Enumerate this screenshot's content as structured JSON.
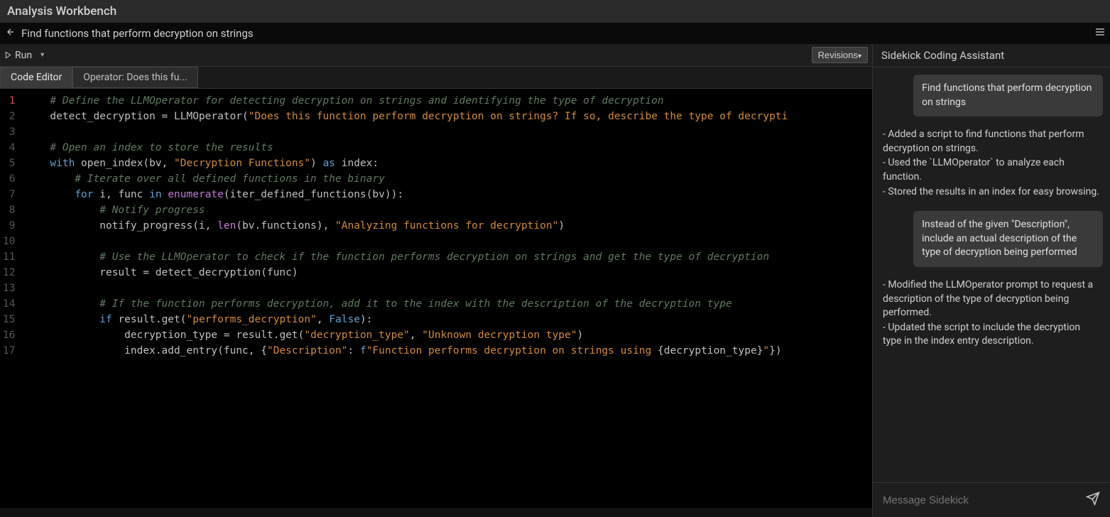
{
  "app": {
    "title": "Analysis Workbench"
  },
  "search": {
    "query": "Find functions that perform decryption on strings"
  },
  "toolbar": {
    "run_label": "Run",
    "revisions_label": "Revisions"
  },
  "tabs": [
    {
      "label": "Code Editor",
      "active": true
    },
    {
      "label": "Operator: Does this fu...",
      "active": false
    }
  ],
  "editor": {
    "lines": [
      {
        "n": 1,
        "tokens": [
          [
            "    ",
            ""
          ],
          [
            "# Define the LLMOperator for detecting decryption on strings and identifying the type of decryption",
            "c-comment"
          ]
        ]
      },
      {
        "n": 2,
        "tokens": [
          [
            "    ",
            ""
          ],
          [
            "detect_decryption",
            "c-ident"
          ],
          [
            " ",
            ""
          ],
          [
            "=",
            "c-op"
          ],
          [
            " ",
            ""
          ],
          [
            "LLMOperator",
            "c-call"
          ],
          [
            "(",
            "c-punct"
          ],
          [
            "\"Does this function perform decryption on strings? If so, describe the type of decrypti",
            "c-string"
          ]
        ]
      },
      {
        "n": 3,
        "tokens": [
          [
            "",
            ""
          ]
        ]
      },
      {
        "n": 4,
        "tokens": [
          [
            "    ",
            ""
          ],
          [
            "# Open an index to store the results",
            "c-comment"
          ]
        ]
      },
      {
        "n": 5,
        "tokens": [
          [
            "    ",
            ""
          ],
          [
            "with",
            "c-kw"
          ],
          [
            " ",
            ""
          ],
          [
            "open_index",
            "c-call"
          ],
          [
            "(",
            "c-punct"
          ],
          [
            "bv",
            "c-ident"
          ],
          [
            ", ",
            "c-punct"
          ],
          [
            "\"Decryption Functions\"",
            "c-string"
          ],
          [
            ")",
            "c-punct"
          ],
          [
            " ",
            ""
          ],
          [
            "as",
            "c-kw"
          ],
          [
            " ",
            ""
          ],
          [
            "index",
            "c-ident"
          ],
          [
            ":",
            "c-punct"
          ]
        ]
      },
      {
        "n": 6,
        "tokens": [
          [
            "        ",
            ""
          ],
          [
            "# Iterate over all defined functions in the binary",
            "c-comment"
          ]
        ]
      },
      {
        "n": 7,
        "tokens": [
          [
            "        ",
            ""
          ],
          [
            "for",
            "c-kw"
          ],
          [
            " ",
            ""
          ],
          [
            "i",
            "c-ident"
          ],
          [
            ", ",
            "c-punct"
          ],
          [
            "func",
            "c-ident"
          ],
          [
            " ",
            ""
          ],
          [
            "in",
            "c-kw"
          ],
          [
            " ",
            ""
          ],
          [
            "enumerate",
            "c-builtin"
          ],
          [
            "(",
            "c-punct"
          ],
          [
            "iter_defined_functions",
            "c-call"
          ],
          [
            "(",
            "c-punct"
          ],
          [
            "bv",
            "c-ident"
          ],
          [
            "))",
            "c-punct"
          ],
          [
            ":",
            "c-punct"
          ]
        ]
      },
      {
        "n": 8,
        "tokens": [
          [
            "            ",
            ""
          ],
          [
            "# Notify progress",
            "c-comment"
          ]
        ]
      },
      {
        "n": 9,
        "tokens": [
          [
            "            ",
            ""
          ],
          [
            "notify_progress",
            "c-call"
          ],
          [
            "(",
            "c-punct"
          ],
          [
            "i",
            "c-ident"
          ],
          [
            ", ",
            "c-punct"
          ],
          [
            "len",
            "c-builtin"
          ],
          [
            "(",
            "c-punct"
          ],
          [
            "bv",
            "c-ident"
          ],
          [
            ".",
            "c-punct"
          ],
          [
            "functions",
            "c-ident"
          ],
          [
            ")",
            "c-punct"
          ],
          [
            ", ",
            "c-punct"
          ],
          [
            "\"Analyzing functions for decryption\"",
            "c-string"
          ],
          [
            ")",
            "c-punct"
          ]
        ]
      },
      {
        "n": 10,
        "tokens": [
          [
            "",
            ""
          ]
        ]
      },
      {
        "n": 11,
        "tokens": [
          [
            "            ",
            ""
          ],
          [
            "# Use the LLMOperator to check if the function performs decryption on strings and get the type of decryption",
            "c-comment"
          ]
        ]
      },
      {
        "n": 12,
        "tokens": [
          [
            "            ",
            ""
          ],
          [
            "result",
            "c-ident"
          ],
          [
            " ",
            ""
          ],
          [
            "=",
            "c-op"
          ],
          [
            " ",
            ""
          ],
          [
            "detect_decryption",
            "c-call"
          ],
          [
            "(",
            "c-punct"
          ],
          [
            "func",
            "c-ident"
          ],
          [
            ")",
            "c-punct"
          ]
        ]
      },
      {
        "n": 13,
        "tokens": [
          [
            "",
            ""
          ]
        ]
      },
      {
        "n": 14,
        "tokens": [
          [
            "            ",
            ""
          ],
          [
            "# If the function performs decryption, add it to the index with the description of the decryption type",
            "c-comment"
          ]
        ]
      },
      {
        "n": 15,
        "tokens": [
          [
            "            ",
            ""
          ],
          [
            "if",
            "c-kw"
          ],
          [
            " ",
            ""
          ],
          [
            "result",
            "c-ident"
          ],
          [
            ".",
            "c-punct"
          ],
          [
            "get",
            "c-call"
          ],
          [
            "(",
            "c-punct"
          ],
          [
            "\"performs_decryption\"",
            "c-string"
          ],
          [
            ", ",
            "c-punct"
          ],
          [
            "False",
            "c-kw"
          ],
          [
            "):",
            "c-punct"
          ]
        ]
      },
      {
        "n": 16,
        "tokens": [
          [
            "                ",
            ""
          ],
          [
            "decryption_type",
            "c-ident"
          ],
          [
            " ",
            ""
          ],
          [
            "=",
            "c-op"
          ],
          [
            " ",
            ""
          ],
          [
            "result",
            "c-ident"
          ],
          [
            ".",
            "c-punct"
          ],
          [
            "get",
            "c-call"
          ],
          [
            "(",
            "c-punct"
          ],
          [
            "\"decryption_type\"",
            "c-string"
          ],
          [
            ", ",
            "c-punct"
          ],
          [
            "\"Unknown decryption type\"",
            "c-string"
          ],
          [
            ")",
            "c-punct"
          ]
        ]
      },
      {
        "n": 17,
        "tokens": [
          [
            "                ",
            ""
          ],
          [
            "index",
            "c-ident"
          ],
          [
            ".",
            "c-punct"
          ],
          [
            "add_entry",
            "c-call"
          ],
          [
            "(",
            "c-punct"
          ],
          [
            "func",
            "c-ident"
          ],
          [
            ", ",
            "c-punct"
          ],
          [
            "{",
            "c-punct"
          ],
          [
            "\"Description\"",
            "c-key"
          ],
          [
            ": ",
            "c-punct"
          ],
          [
            "f",
            "c-kw"
          ],
          [
            "\"Function performs decryption on strings using ",
            "c-string"
          ],
          [
            "{",
            "c-punct"
          ],
          [
            "decryption_type",
            "c-ident"
          ],
          [
            "}",
            "c-punct"
          ],
          [
            "\"",
            "c-string"
          ],
          [
            "})",
            "c-punct"
          ]
        ]
      }
    ]
  },
  "sidekick": {
    "title": "Sidekick Coding Assistant",
    "messages": [
      {
        "role": "user",
        "text": "Find functions that perform decryption on strings"
      },
      {
        "role": "assistant",
        "text": "- Added a script to find functions that perform decryption on strings.\n- Used the `LLMOperator` to analyze each function.\n- Stored the results in an index for easy browsing."
      },
      {
        "role": "user",
        "text": "Instead of the given \"Description\", include an actual description of the type of decryption being performed"
      },
      {
        "role": "assistant",
        "text": "- Modified the LLMOperator prompt to request a description of the type of decryption being performed.\n- Updated the script to include the decryption type in the index entry description."
      }
    ],
    "input_placeholder": "Message Sidekick"
  }
}
